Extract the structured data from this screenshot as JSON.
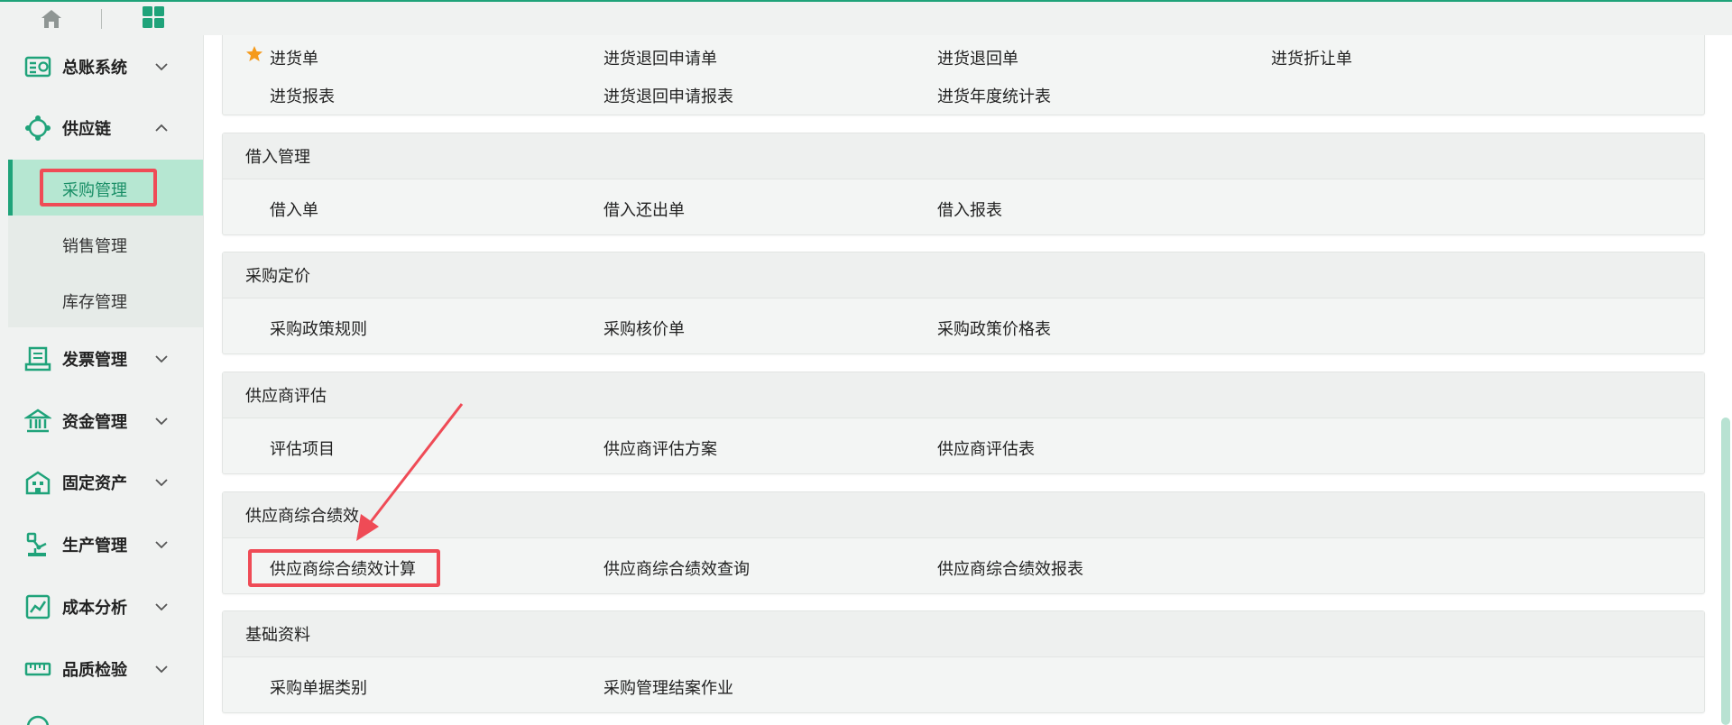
{
  "sidebar": {
    "items": [
      {
        "label": "总账系统",
        "icon": "ledger-icon"
      },
      {
        "label": "供应链",
        "icon": "supply-chain-icon"
      },
      {
        "label": "发票管理",
        "icon": "invoice-icon"
      },
      {
        "label": "资金管理",
        "icon": "bank-icon"
      },
      {
        "label": "固定资产",
        "icon": "building-icon"
      },
      {
        "label": "生产管理",
        "icon": "robot-arm-icon"
      },
      {
        "label": "成本分析",
        "icon": "chart-icon"
      },
      {
        "label": "品质检验",
        "icon": "ruler-icon"
      }
    ],
    "submenu": [
      "采购管理",
      "销售管理",
      "库存管理"
    ]
  },
  "sections": [
    {
      "title": "",
      "rows": [
        [
          "进货单",
          "进货退回申请单",
          "进货退回单",
          "进货折让单"
        ],
        [
          "进货报表",
          "进货退回申请报表",
          "进货年度统计表"
        ]
      ]
    },
    {
      "title": "借入管理",
      "rows": [
        [
          "借入单",
          "借入还出单",
          "借入报表"
        ]
      ]
    },
    {
      "title": "采购定价",
      "rows": [
        [
          "采购政策规则",
          "采购核价单",
          "采购政策价格表"
        ]
      ]
    },
    {
      "title": "供应商评估",
      "rows": [
        [
          "评估项目",
          "供应商评估方案",
          "供应商评估表"
        ]
      ]
    },
    {
      "title": "供应商综合绩效",
      "rows": [
        [
          "供应商综合绩效计算",
          "供应商综合绩效查询",
          "供应商综合绩效报表"
        ]
      ]
    },
    {
      "title": "基础资料",
      "rows": [
        [
          "采购单据类别",
          "采购管理结案作业"
        ]
      ]
    }
  ],
  "colors": {
    "accent": "#1fa37a",
    "highlight": "#ef4b56",
    "star": "#f59a1b"
  }
}
